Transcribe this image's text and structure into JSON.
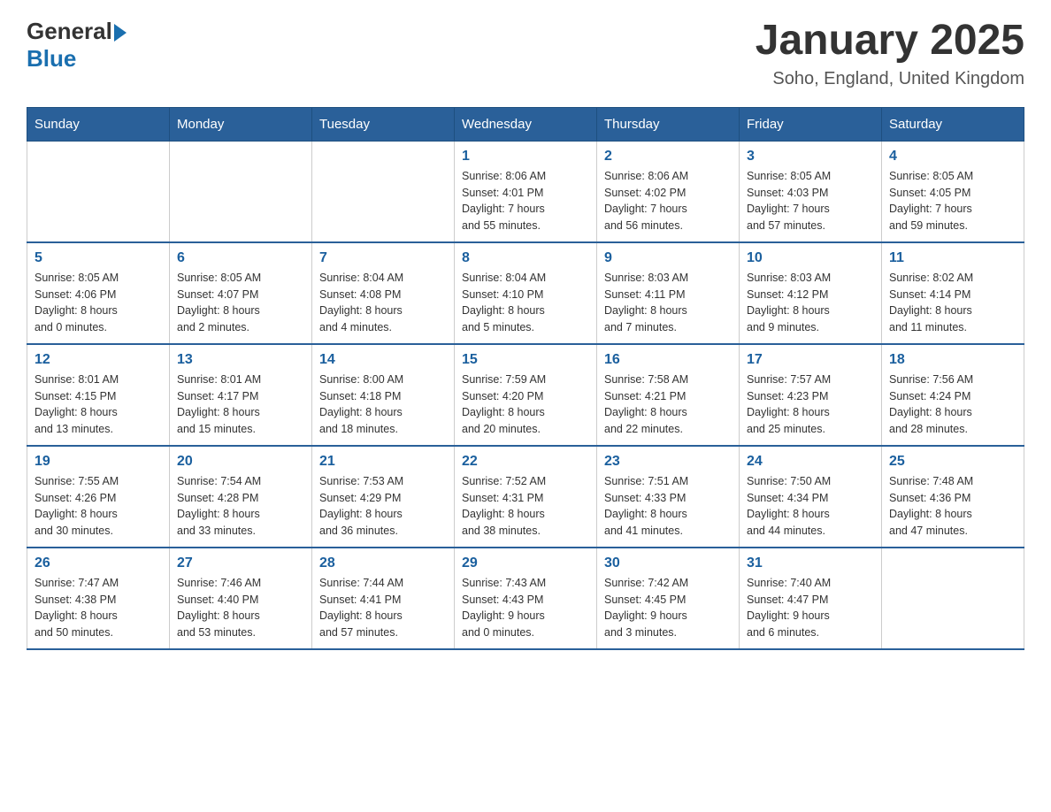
{
  "header": {
    "logo": {
      "text_general": "General",
      "text_blue": "Blue",
      "arrow": true
    },
    "title": "January 2025",
    "subtitle": "Soho, England, United Kingdom"
  },
  "calendar": {
    "days_of_week": [
      "Sunday",
      "Monday",
      "Tuesday",
      "Wednesday",
      "Thursday",
      "Friday",
      "Saturday"
    ],
    "weeks": [
      [
        {
          "day": "",
          "info": ""
        },
        {
          "day": "",
          "info": ""
        },
        {
          "day": "",
          "info": ""
        },
        {
          "day": "1",
          "info": "Sunrise: 8:06 AM\nSunset: 4:01 PM\nDaylight: 7 hours\nand 55 minutes."
        },
        {
          "day": "2",
          "info": "Sunrise: 8:06 AM\nSunset: 4:02 PM\nDaylight: 7 hours\nand 56 minutes."
        },
        {
          "day": "3",
          "info": "Sunrise: 8:05 AM\nSunset: 4:03 PM\nDaylight: 7 hours\nand 57 minutes."
        },
        {
          "day": "4",
          "info": "Sunrise: 8:05 AM\nSunset: 4:05 PM\nDaylight: 7 hours\nand 59 minutes."
        }
      ],
      [
        {
          "day": "5",
          "info": "Sunrise: 8:05 AM\nSunset: 4:06 PM\nDaylight: 8 hours\nand 0 minutes."
        },
        {
          "day": "6",
          "info": "Sunrise: 8:05 AM\nSunset: 4:07 PM\nDaylight: 8 hours\nand 2 minutes."
        },
        {
          "day": "7",
          "info": "Sunrise: 8:04 AM\nSunset: 4:08 PM\nDaylight: 8 hours\nand 4 minutes."
        },
        {
          "day": "8",
          "info": "Sunrise: 8:04 AM\nSunset: 4:10 PM\nDaylight: 8 hours\nand 5 minutes."
        },
        {
          "day": "9",
          "info": "Sunrise: 8:03 AM\nSunset: 4:11 PM\nDaylight: 8 hours\nand 7 minutes."
        },
        {
          "day": "10",
          "info": "Sunrise: 8:03 AM\nSunset: 4:12 PM\nDaylight: 8 hours\nand 9 minutes."
        },
        {
          "day": "11",
          "info": "Sunrise: 8:02 AM\nSunset: 4:14 PM\nDaylight: 8 hours\nand 11 minutes."
        }
      ],
      [
        {
          "day": "12",
          "info": "Sunrise: 8:01 AM\nSunset: 4:15 PM\nDaylight: 8 hours\nand 13 minutes."
        },
        {
          "day": "13",
          "info": "Sunrise: 8:01 AM\nSunset: 4:17 PM\nDaylight: 8 hours\nand 15 minutes."
        },
        {
          "day": "14",
          "info": "Sunrise: 8:00 AM\nSunset: 4:18 PM\nDaylight: 8 hours\nand 18 minutes."
        },
        {
          "day": "15",
          "info": "Sunrise: 7:59 AM\nSunset: 4:20 PM\nDaylight: 8 hours\nand 20 minutes."
        },
        {
          "day": "16",
          "info": "Sunrise: 7:58 AM\nSunset: 4:21 PM\nDaylight: 8 hours\nand 22 minutes."
        },
        {
          "day": "17",
          "info": "Sunrise: 7:57 AM\nSunset: 4:23 PM\nDaylight: 8 hours\nand 25 minutes."
        },
        {
          "day": "18",
          "info": "Sunrise: 7:56 AM\nSunset: 4:24 PM\nDaylight: 8 hours\nand 28 minutes."
        }
      ],
      [
        {
          "day": "19",
          "info": "Sunrise: 7:55 AM\nSunset: 4:26 PM\nDaylight: 8 hours\nand 30 minutes."
        },
        {
          "day": "20",
          "info": "Sunrise: 7:54 AM\nSunset: 4:28 PM\nDaylight: 8 hours\nand 33 minutes."
        },
        {
          "day": "21",
          "info": "Sunrise: 7:53 AM\nSunset: 4:29 PM\nDaylight: 8 hours\nand 36 minutes."
        },
        {
          "day": "22",
          "info": "Sunrise: 7:52 AM\nSunset: 4:31 PM\nDaylight: 8 hours\nand 38 minutes."
        },
        {
          "day": "23",
          "info": "Sunrise: 7:51 AM\nSunset: 4:33 PM\nDaylight: 8 hours\nand 41 minutes."
        },
        {
          "day": "24",
          "info": "Sunrise: 7:50 AM\nSunset: 4:34 PM\nDaylight: 8 hours\nand 44 minutes."
        },
        {
          "day": "25",
          "info": "Sunrise: 7:48 AM\nSunset: 4:36 PM\nDaylight: 8 hours\nand 47 minutes."
        }
      ],
      [
        {
          "day": "26",
          "info": "Sunrise: 7:47 AM\nSunset: 4:38 PM\nDaylight: 8 hours\nand 50 minutes."
        },
        {
          "day": "27",
          "info": "Sunrise: 7:46 AM\nSunset: 4:40 PM\nDaylight: 8 hours\nand 53 minutes."
        },
        {
          "day": "28",
          "info": "Sunrise: 7:44 AM\nSunset: 4:41 PM\nDaylight: 8 hours\nand 57 minutes."
        },
        {
          "day": "29",
          "info": "Sunrise: 7:43 AM\nSunset: 4:43 PM\nDaylight: 9 hours\nand 0 minutes."
        },
        {
          "day": "30",
          "info": "Sunrise: 7:42 AM\nSunset: 4:45 PM\nDaylight: 9 hours\nand 3 minutes."
        },
        {
          "day": "31",
          "info": "Sunrise: 7:40 AM\nSunset: 4:47 PM\nDaylight: 9 hours\nand 6 minutes."
        },
        {
          "day": "",
          "info": ""
        }
      ]
    ]
  }
}
